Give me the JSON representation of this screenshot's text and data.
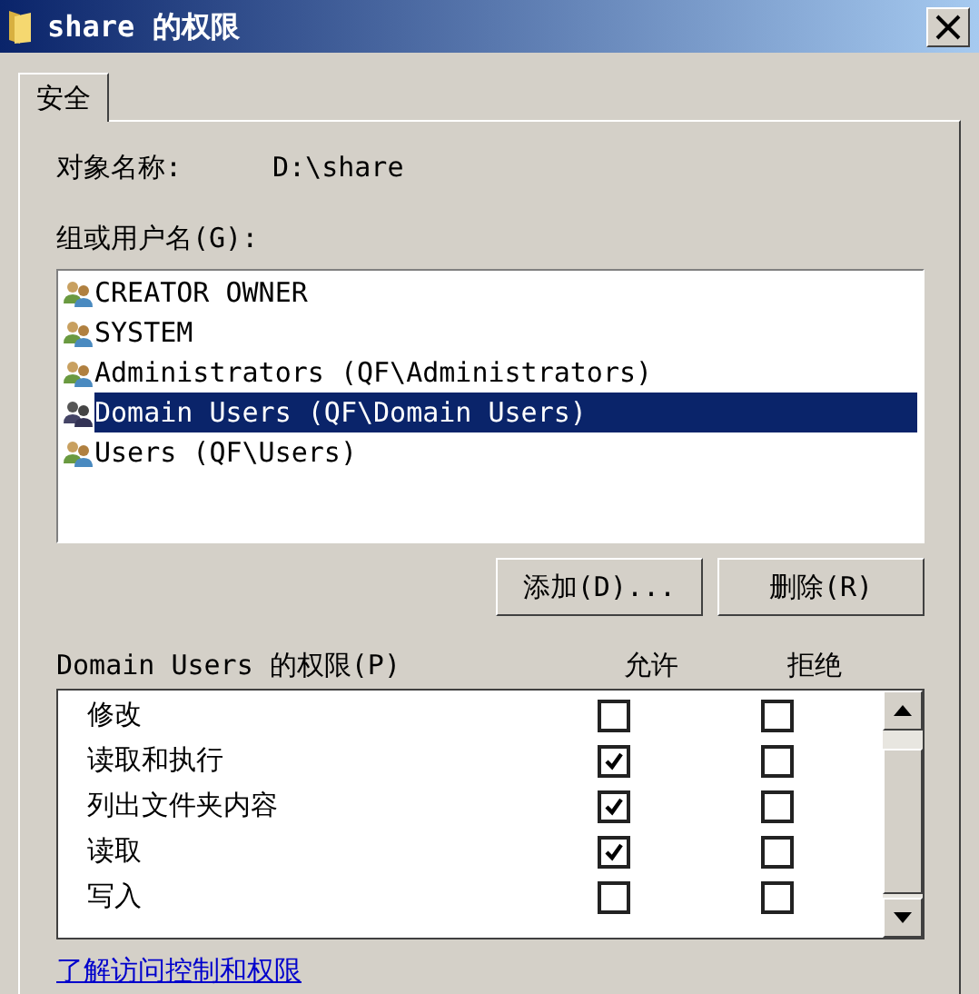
{
  "window": {
    "title": "share 的权限"
  },
  "tabs": [
    {
      "label": "安全",
      "selected": true
    }
  ],
  "object_name": {
    "label": "对象名称:",
    "value": "D:\\share"
  },
  "groups": {
    "label": "组或用户名(G):",
    "items": [
      {
        "name": "CREATOR OWNER",
        "selected": false
      },
      {
        "name": "SYSTEM",
        "selected": false
      },
      {
        "name": "Administrators (QF\\Administrators)",
        "selected": false
      },
      {
        "name": "Domain Users (QF\\Domain Users)",
        "selected": true
      },
      {
        "name": "Users (QF\\Users)",
        "selected": false
      }
    ]
  },
  "buttons": [
    "添加(D)...",
    "删除(R)"
  ],
  "permissions": {
    "label": "Domain Users 的权限(P)",
    "columns": [
      "允许",
      "拒绝"
    ],
    "rows": [
      {
        "name": "修改",
        "allow": false,
        "deny": false
      },
      {
        "name": "读取和执行",
        "allow": true,
        "deny": false
      },
      {
        "name": "列出文件夹内容",
        "allow": true,
        "deny": false
      },
      {
        "name": "读取",
        "allow": true,
        "deny": false
      },
      {
        "name": "写入",
        "allow": false,
        "deny": false
      }
    ]
  },
  "link": "了解访问控制和权限"
}
